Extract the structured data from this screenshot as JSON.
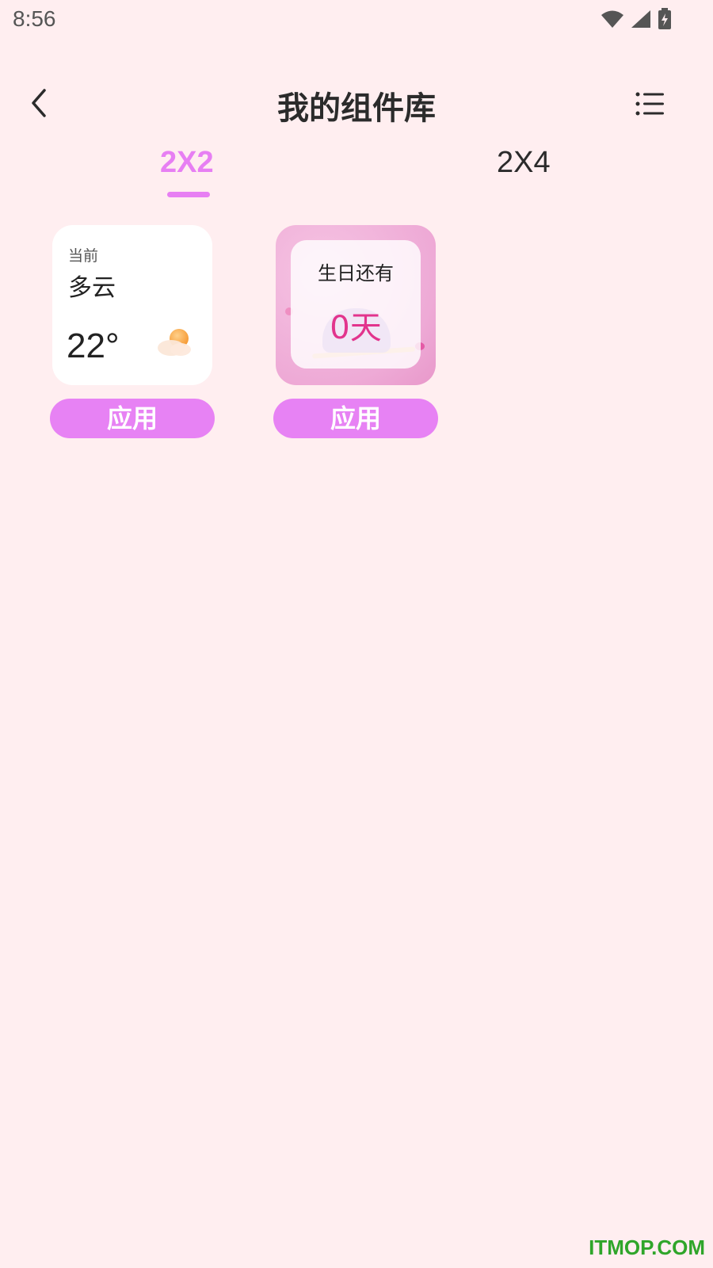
{
  "status_bar": {
    "time": "8:56",
    "icons": [
      "wifi-icon",
      "signal-icon",
      "battery-charging-icon"
    ]
  },
  "header": {
    "title": "我的组件库",
    "back_icon": "back-arrow-icon",
    "menu_icon": "list-menu-icon"
  },
  "tabs": [
    {
      "label": "2X2",
      "selected": true
    },
    {
      "label": "2X4",
      "selected": false
    }
  ],
  "accent_color": "#e77ff3",
  "widgets": [
    {
      "type": "weather",
      "label": "当前",
      "condition": "多云",
      "temperature": "22°",
      "icon": "partly-cloudy-icon",
      "apply_label": "应用"
    },
    {
      "type": "birthday",
      "label": "生日还有",
      "days": "0天",
      "apply_label": "应用"
    }
  ],
  "watermark": "ITMOP.COM"
}
